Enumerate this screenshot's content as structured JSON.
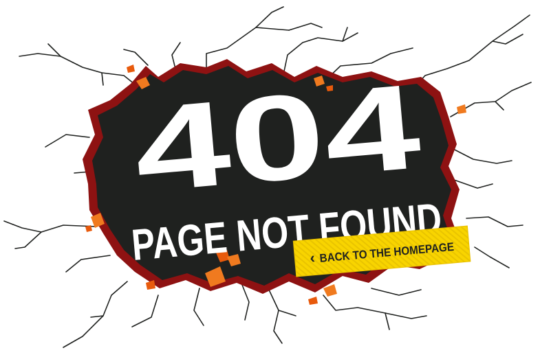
{
  "error": {
    "code": "404",
    "message": "PAGE NOT FOUND"
  },
  "cta": {
    "chevron": "‹",
    "label": "BACK TO THE HOMEPAGE"
  },
  "colors": {
    "hole": "#1f211f",
    "hole_rim": "#8e1212",
    "ember": "#f07a1f",
    "ember_hot": "#e85a0c",
    "crack": "#1f211f",
    "button": "#f8d400",
    "button_edge": "#e8bf00",
    "text": "#ffffff"
  }
}
